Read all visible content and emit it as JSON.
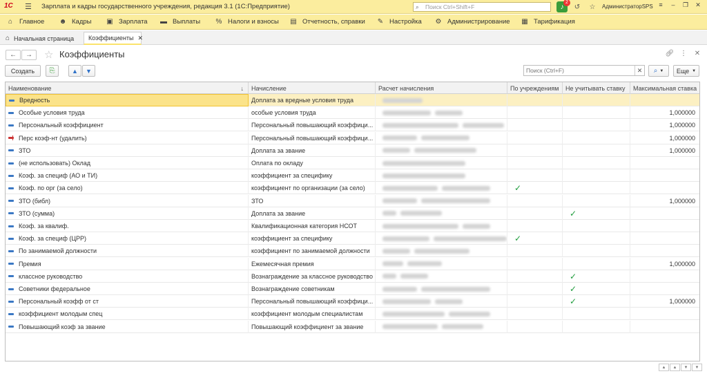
{
  "app": {
    "logo": "1С",
    "title": "Зарплата и кадры государственного учреждения, редакция 3.1  (1С:Предприятие)",
    "search_placeholder": "Поиск Ctrl+Shift+F",
    "notifications_count": "2",
    "user": "АдминистраторSPS"
  },
  "menu": [
    {
      "label": "Главное",
      "icon": "home-icon"
    },
    {
      "label": "Кадры",
      "icon": "people-icon"
    },
    {
      "label": "Зарплата",
      "icon": "wallet-icon"
    },
    {
      "label": "Выплаты",
      "icon": "card-icon"
    },
    {
      "label": "Налоги и взносы",
      "icon": "percent-icon"
    },
    {
      "label": "Отчетность, справки",
      "icon": "report-icon"
    },
    {
      "label": "Настройка",
      "icon": "wrench-icon"
    },
    {
      "label": "Администрирование",
      "icon": "gear-icon"
    },
    {
      "label": "Тарификация",
      "icon": "tariff-icon"
    }
  ],
  "tabs": {
    "home": "Начальная страница",
    "active": "Коэффициенты"
  },
  "form": {
    "title": "Коэффициенты",
    "create_label": "Создать",
    "search_placeholder": "Поиск (Ctrl+F)",
    "more_label": "Еще"
  },
  "table": {
    "columns": [
      "Наименование",
      "Начисление",
      "Расчет начисления",
      "По учреждениям",
      "Не учитывать ставку",
      "Максимальная ставка"
    ],
    "rows": [
      {
        "name": "Вредность",
        "accrual": "Доплата за вредные условия труда",
        "by_inst": false,
        "ignore_rate": false,
        "max_rate": "",
        "selected": true,
        "icon": "item"
      },
      {
        "name": "Особые условия труда",
        "accrual": "особые условия труда",
        "by_inst": false,
        "ignore_rate": false,
        "max_rate": "1,000000",
        "icon": "item"
      },
      {
        "name": "Персональный коэффициент",
        "accrual": "Персональный повышающий коэффици...",
        "by_inst": false,
        "ignore_rate": false,
        "max_rate": "1,000000",
        "icon": "item"
      },
      {
        "name": "Перс коэф-нт (удалить)",
        "accrual": "Персональный повышающий коэффици...",
        "by_inst": false,
        "ignore_rate": false,
        "max_rate": "1,000000",
        "icon": "deleted"
      },
      {
        "name": "ЗТО",
        "accrual": "Доплата за звание",
        "by_inst": false,
        "ignore_rate": false,
        "max_rate": "1,000000",
        "icon": "item"
      },
      {
        "name": "(не использовать) Оклад",
        "accrual": "Оплата по окладу",
        "by_inst": false,
        "ignore_rate": false,
        "max_rate": "",
        "icon": "item"
      },
      {
        "name": "Коэф. за специф (АО и ТИ)",
        "accrual": "коэффициент за специфику",
        "by_inst": false,
        "ignore_rate": false,
        "max_rate": "",
        "icon": "item"
      },
      {
        "name": "Коэф. по орг (за село)",
        "accrual": "коэффициент по организации (за село)",
        "by_inst": true,
        "ignore_rate": false,
        "max_rate": "",
        "icon": "item"
      },
      {
        "name": "ЗТО (библ)",
        "accrual": "ЗТО",
        "by_inst": false,
        "ignore_rate": false,
        "max_rate": "1,000000",
        "icon": "item"
      },
      {
        "name": "ЗТО (сумма)",
        "accrual": "Доплата за звание",
        "by_inst": false,
        "ignore_rate": true,
        "max_rate": "",
        "icon": "item"
      },
      {
        "name": "Коэф. за квалиф.",
        "accrual": "Квалификационная категория НСОТ",
        "by_inst": false,
        "ignore_rate": false,
        "max_rate": "",
        "icon": "item"
      },
      {
        "name": "Коэф. за специф (ЦРР)",
        "accrual": "коэффициент за специфику",
        "by_inst": true,
        "ignore_rate": false,
        "max_rate": "",
        "icon": "item"
      },
      {
        "name": "По занимаемой должности",
        "accrual": "коэффициент по занимаемой должности",
        "by_inst": false,
        "ignore_rate": false,
        "max_rate": "",
        "icon": "item"
      },
      {
        "name": "Премия",
        "accrual": "Ежемесячная премия",
        "by_inst": false,
        "ignore_rate": false,
        "max_rate": "1,000000",
        "icon": "item"
      },
      {
        "name": "классное руководство",
        "accrual": "Вознаграждение за классное руководство",
        "by_inst": false,
        "ignore_rate": true,
        "max_rate": "",
        "icon": "item"
      },
      {
        "name": "Советники федеральное",
        "accrual": "Вознаграждение советникам",
        "by_inst": false,
        "ignore_rate": true,
        "max_rate": "",
        "icon": "item"
      },
      {
        "name": "Персональный коэфф от ст",
        "accrual": "Персональный повышающий коэффици...",
        "by_inst": false,
        "ignore_rate": true,
        "max_rate": "1,000000",
        "icon": "item"
      },
      {
        "name": " коэффициент молодым спец",
        "accrual": "коэффициент молодым специалистам",
        "by_inst": false,
        "ignore_rate": false,
        "max_rate": "",
        "icon": "item"
      },
      {
        "name": "Повышающий коэф за звание",
        "accrual": "Повышающий коэффициент за звание",
        "by_inst": false,
        "ignore_rate": false,
        "max_rate": "",
        "icon": "item"
      }
    ]
  },
  "checkmark": "✓"
}
